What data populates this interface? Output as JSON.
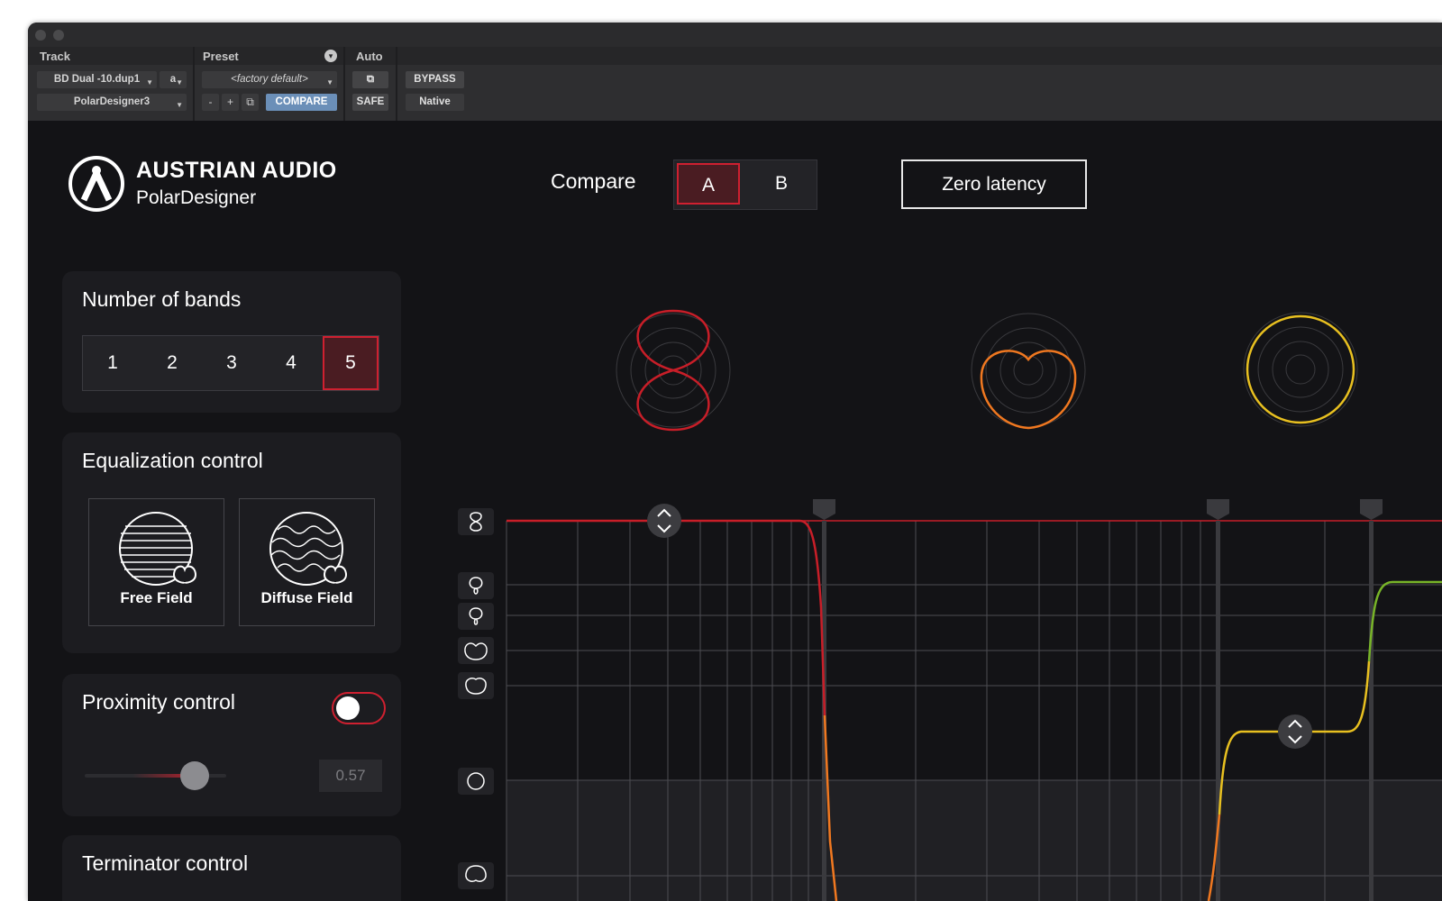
{
  "protools": {
    "track_label": "Track",
    "preset_label": "Preset",
    "auto_label": "Auto",
    "track_name": "BD Dual -10.dup1",
    "track_channel": "a",
    "plugin_name": "PolarDesigner3",
    "preset_name": "<factory default>",
    "minus_label": "-",
    "plus_label": "+",
    "compare_label": "COMPARE",
    "bypass_label": "BYPASS",
    "safe_label": "SAFE",
    "native_label": "Native"
  },
  "header": {
    "brand": "AUSTRIAN AUDIO",
    "product": "PolarDesigner",
    "compare_label": "Compare",
    "compare_options": [
      "A",
      "B"
    ],
    "compare_selected": "A",
    "zero_latency_label": "Zero latency"
  },
  "bands_panel": {
    "title": "Number of bands",
    "options": [
      "1",
      "2",
      "3",
      "4",
      "5"
    ],
    "selected": "5"
  },
  "eq_panel": {
    "title": "Equalization control",
    "free_field_label": "Free Field",
    "diffuse_field_label": "Diffuse Field"
  },
  "proximity_panel": {
    "title": "Proximity control",
    "toggle_on": false,
    "slider_value": "0.57"
  },
  "terminator_panel": {
    "title": "Terminator control"
  },
  "colors": {
    "accent_red": "#cf2030",
    "band1": "#c81e28",
    "band2": "#f07820",
    "band3": "#e8c020",
    "band4": "#78b428"
  },
  "polar_patterns": [
    {
      "pattern": "figure-8",
      "color": "#c81e28"
    },
    {
      "pattern": "cardioid",
      "color": "#f07820"
    },
    {
      "pattern": "omni",
      "color": "#e8c020"
    }
  ],
  "pattern_icons": [
    "figure-8-icon",
    "supercardioid-icon",
    "hypercardioid-icon",
    "wide-cardioid-icon",
    "cardioid-icon",
    "omni-icon",
    "reverse-cardioid-icon"
  ]
}
